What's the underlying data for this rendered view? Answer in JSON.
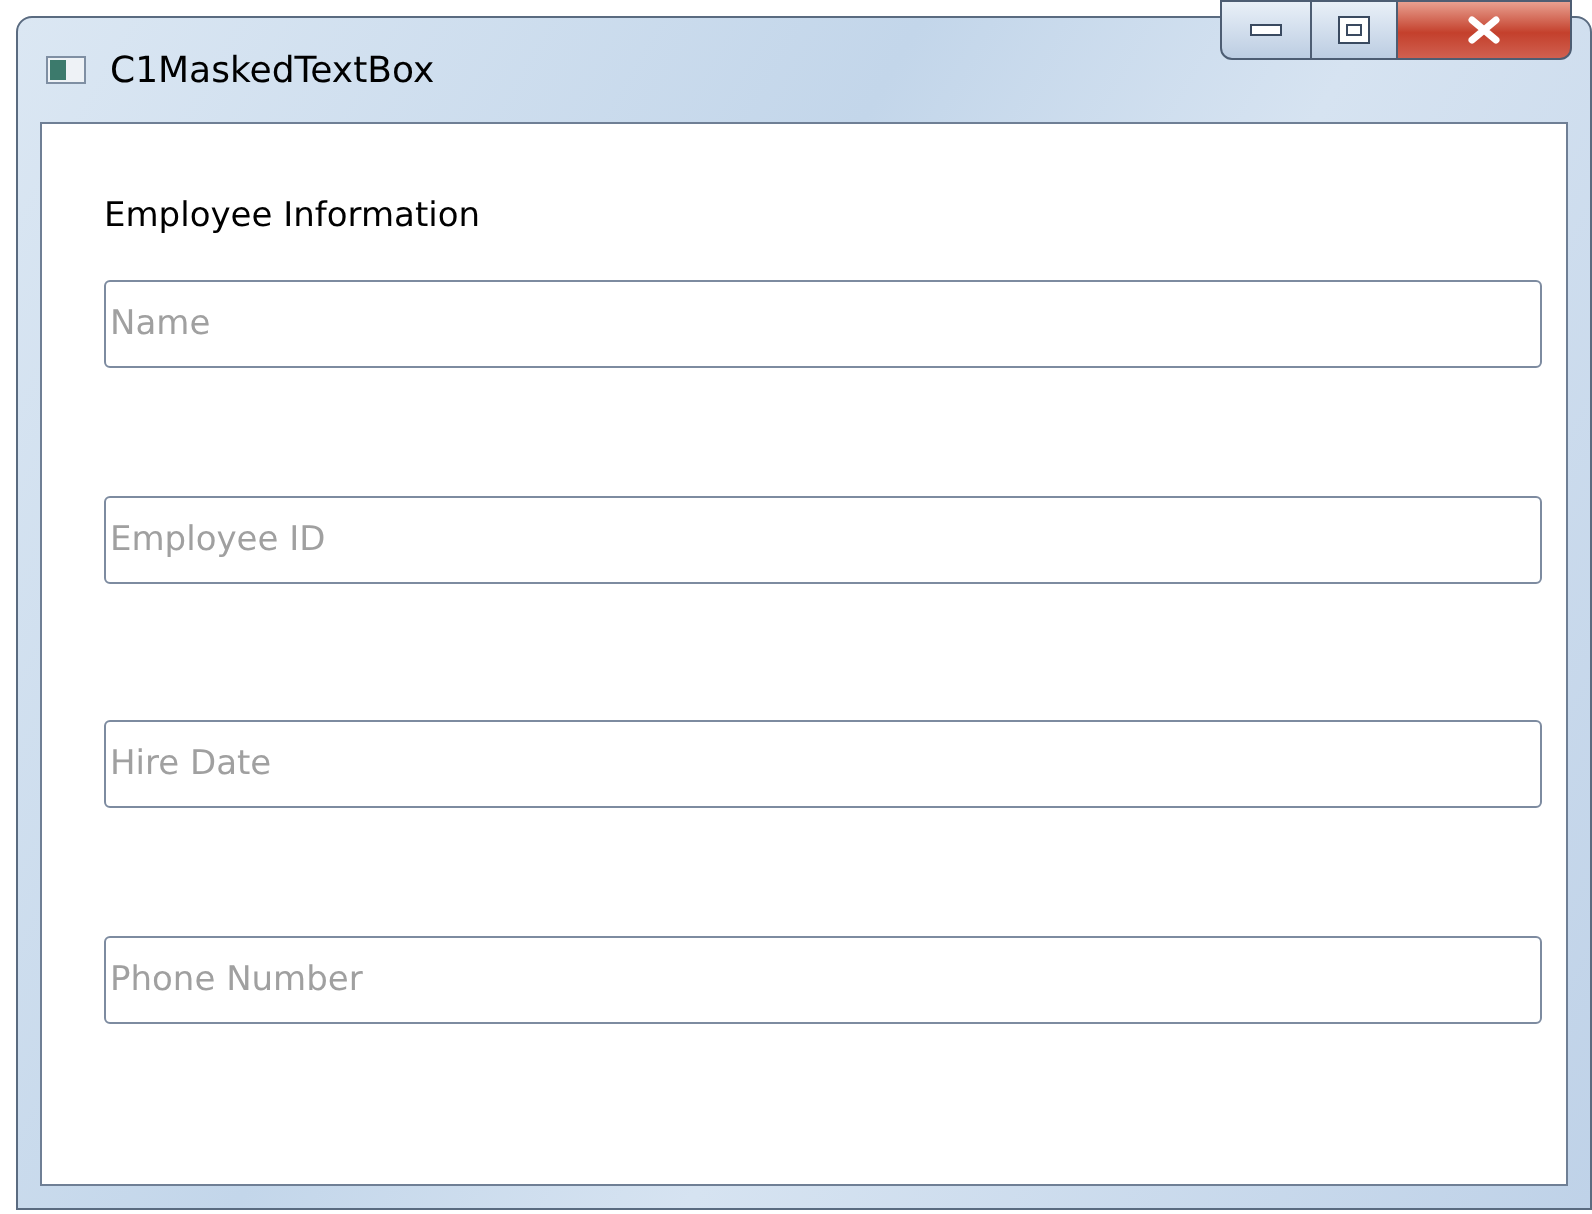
{
  "window": {
    "title": "C1MaskedTextBox"
  },
  "heading": "Employee Information",
  "fields": [
    {
      "placeholder": "Name"
    },
    {
      "placeholder": "Employee ID"
    },
    {
      "placeholder": "Hire Date"
    },
    {
      "placeholder": "Phone Number"
    }
  ]
}
